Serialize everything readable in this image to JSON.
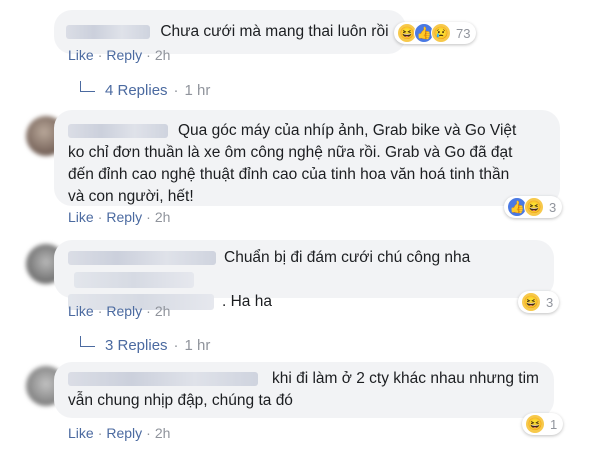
{
  "comments": [
    {
      "text": "Chưa cưới mà mang thai luôn rồi",
      "reactions": {
        "icons": [
          "haha-icon",
          "like-icon",
          "sad-icon"
        ],
        "count": "73"
      },
      "actions": {
        "like": "Like",
        "reply": "Reply",
        "time": "2h"
      }
    },
    {
      "line1": "Qua góc máy của nhíp ảnh, Grab bike và Go Việt",
      "line2": "ko chỉ đơn thuần là xe ôm công nghệ nữa rồi. Grab và Go đã đạt",
      "line3": "đến đỉnh cao nghệ thuật đỉnh cao của tinh hoa văn hoá tinh thần",
      "line4": "và con người, hết!",
      "reactions": {
        "icons": [
          "like-icon",
          "haha-icon"
        ],
        "count": "3"
      },
      "actions": {
        "like": "Like",
        "reply": "Reply",
        "time": "2h"
      }
    },
    {
      "line1": "Chuẩn bị đi đám cưới chú công nha",
      "line2": ". Ha ha",
      "reactions": {
        "icons": [
          "haha-icon"
        ],
        "count": "3"
      },
      "actions": {
        "like": "Like",
        "reply": "Reply",
        "time": "2h"
      }
    },
    {
      "line1": "khi đi làm ở 2 cty khác nhau nhưng tim",
      "line2": "vẫn chung nhịp đập, chúng ta đó",
      "reactions": {
        "icons": [
          "haha-icon"
        ],
        "count": "1"
      },
      "actions": {
        "like": "Like",
        "reply": "Reply",
        "time": "2h"
      }
    }
  ],
  "reply_threads": [
    {
      "label": "4 Replies",
      "time": "1 hr"
    },
    {
      "label": "3 Replies",
      "time": "1 hr"
    }
  ],
  "separator": "·",
  "colors": {
    "link": "#4b6aa0",
    "bubble": "#f2f3f5",
    "meta": "#90949c"
  }
}
